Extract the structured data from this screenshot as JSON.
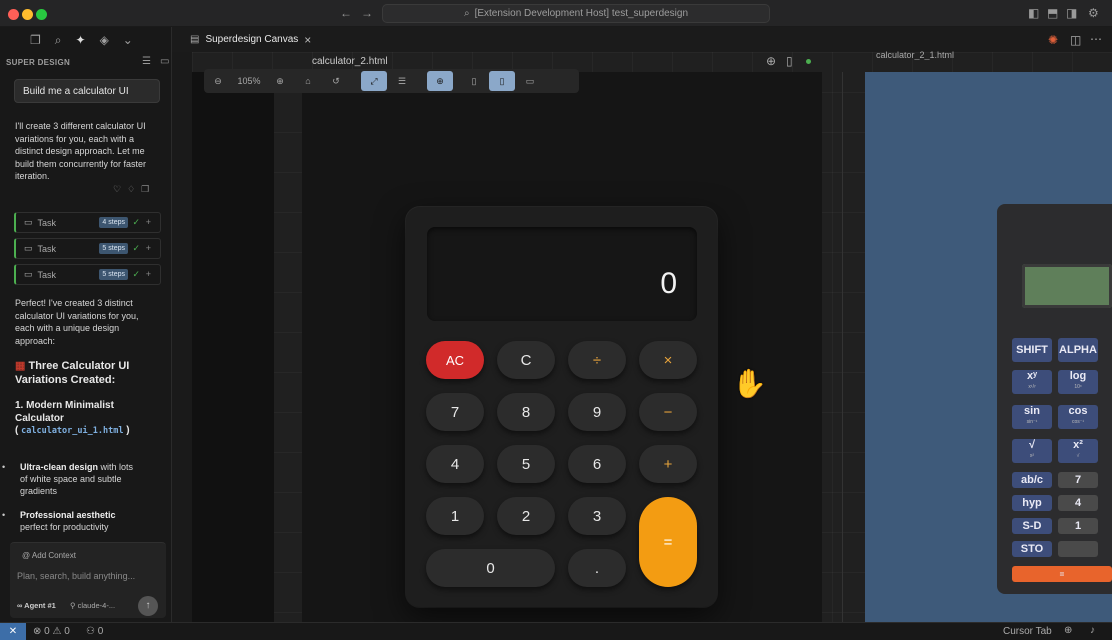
{
  "titlebar": {
    "command_center": "[Extension Development Host] test_superdesign"
  },
  "sidebar": {
    "title": "SUPER DESIGN",
    "prompt": "Build me a calculator UI",
    "intro": "I'll create 3 different calculator UI variations for you, each with a distinct design approach. Let me build them concurrently for faster iteration.",
    "tasks": [
      {
        "label": "Task",
        "badge": "4 steps"
      },
      {
        "label": "Task",
        "badge": "5 steps"
      },
      {
        "label": "Task",
        "badge": "5 steps"
      }
    ],
    "summary": "Perfect! I've created 3 distinct calculator UI variations for you, each with a unique design approach:",
    "heading": "Three Calculator UI Variations Created:",
    "variant_title": "1. Modern Minimalist Calculator",
    "variant_file": "calculator_ui_1.html",
    "bullets": [
      {
        "bold": "Ultra-clean design",
        "text": " with lots of white space and subtle gradients"
      },
      {
        "bold": "Professional aesthetic",
        "text": " perfect for productivity"
      }
    ],
    "add_context": "Add Context",
    "input_placeholder": "Plan, search, build anything...",
    "agent": "Agent #1",
    "model": "claude-4-..."
  },
  "editor": {
    "tab_label": "Superdesign Canvas"
  },
  "canvas": {
    "zoom": "105%",
    "frame_title": "calculator_2.html",
    "frame3_title": "calculator_2_1.html",
    "display_value": "0",
    "keys": [
      {
        "label": "AC",
        "cls": "ac"
      },
      {
        "label": "C",
        "cls": ""
      },
      {
        "label": "÷",
        "cls": "op"
      },
      {
        "label": "×",
        "cls": "op"
      },
      {
        "label": "7",
        "cls": ""
      },
      {
        "label": "8",
        "cls": ""
      },
      {
        "label": "9",
        "cls": ""
      },
      {
        "label": "−",
        "cls": "op"
      },
      {
        "label": "4",
        "cls": ""
      },
      {
        "label": "5",
        "cls": ""
      },
      {
        "label": "6",
        "cls": ""
      },
      {
        "label": "+",
        "cls": "op"
      },
      {
        "label": "1",
        "cls": ""
      },
      {
        "label": "2",
        "cls": ""
      },
      {
        "label": "3",
        "cls": ""
      },
      {
        "label": "=",
        "cls": "eq"
      },
      {
        "label": "0",
        "cls": "zero"
      },
      {
        "label": ".",
        "cls": ""
      }
    ],
    "sci_keys": [
      {
        "label": "SHIFT",
        "sub": ""
      },
      {
        "label": "ALPHA",
        "sub": ""
      },
      {
        "label": "xʸ",
        "sub": "x¹/ʸ"
      },
      {
        "label": "log",
        "sub": "10ˣ"
      },
      {
        "label": "sin",
        "sub": "sin⁻¹"
      },
      {
        "label": "cos",
        "sub": "cos⁻¹"
      },
      {
        "label": "√",
        "sub": "x²"
      },
      {
        "label": "x²",
        "sub": "√"
      },
      {
        "label": "ab/c",
        "sub": ""
      },
      {
        "label": "7",
        "sub": ""
      },
      {
        "label": "hyp",
        "sub": ""
      },
      {
        "label": "4",
        "sub": ""
      },
      {
        "label": "S-D",
        "sub": ""
      },
      {
        "label": "1",
        "sub": ""
      },
      {
        "label": "STO",
        "sub": ""
      },
      {
        "label": "",
        "sub": ""
      },
      {
        "label": "=",
        "sub": ""
      }
    ]
  },
  "statusbar": {
    "errors": "0",
    "warnings": "0",
    "ports": "0",
    "cursor_tab": "Cursor Tab"
  }
}
